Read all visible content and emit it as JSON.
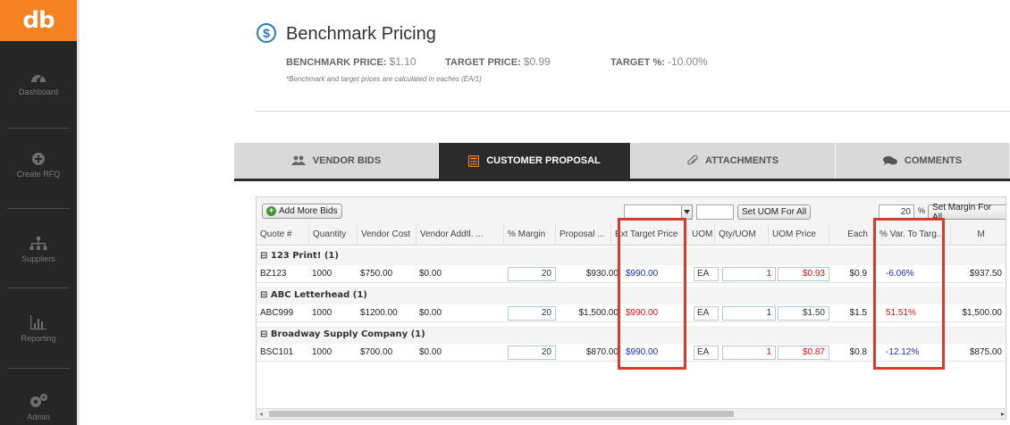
{
  "app": {
    "logo": "db"
  },
  "sidebar": {
    "items": [
      {
        "label": "Dashboard",
        "icon": "gauge-icon"
      },
      {
        "label": "Create RFQ",
        "icon": "plus-circle-icon"
      },
      {
        "label": "Suppliers",
        "icon": "org-chart-icon"
      },
      {
        "label": "Reporting",
        "icon": "bar-chart-icon"
      },
      {
        "label": "Admin",
        "icon": "gears-icon"
      }
    ]
  },
  "header": {
    "title": "Benchmark Pricing",
    "benchmark_label": "BENCHMARK PRICE:",
    "benchmark_value": "$1.10",
    "target_label": "TARGET PRICE:",
    "target_value": "$0.99",
    "target_pct_label": "TARGET %:",
    "target_pct_value": "-10.00%",
    "note": "*Benchmark and target prices are calculated in eaches (EA/1)"
  },
  "tabs": [
    {
      "label": "VENDOR BIDS",
      "icon": "users-icon",
      "active": false
    },
    {
      "label": "CUSTOMER PROPOSAL",
      "icon": "calculator-icon",
      "active": true
    },
    {
      "label": "ATTACHMENTS",
      "icon": "paperclip-icon",
      "active": false
    },
    {
      "label": "COMMENTS",
      "icon": "chat-icon",
      "active": false
    }
  ],
  "toolbar": {
    "add_bids_label": "Add More Bids",
    "uom_select_value": "",
    "uom_input_value": "",
    "set_uom_label": "Set UOM For All",
    "margin_value": "20",
    "margin_pct": "%",
    "set_margin_label": "Set Margin For All"
  },
  "columns": [
    "Quote #",
    "Quantity",
    "Vendor Cost",
    "Vendor Addtl. ...",
    "% Margin",
    "Proposal ...",
    "Ext Target Price",
    "UOM",
    "Qty/UOM",
    "UOM Price",
    "Each",
    "% Var. To Targ...",
    "M"
  ],
  "groups": [
    {
      "name": "123 Print! (1)",
      "row": {
        "quote": "BZ123",
        "quantity": "1000",
        "vendor_cost": "$750.00",
        "addtl": "$0.00",
        "margin": "20",
        "proposal": "$930.00",
        "ext_target": "$990.00",
        "ext_target_color": "blue",
        "uom": "EA",
        "qty_uom": "1",
        "qty_uom_red": true,
        "uom_price": "$0.93",
        "uom_price_red": true,
        "each": "$0.9",
        "var": "-6.06%",
        "var_color": "blue",
        "m": "$937.50"
      }
    },
    {
      "name": "ABC Letterhead (1)",
      "row": {
        "quote": "ABC999",
        "quantity": "1000",
        "vendor_cost": "$1200.00",
        "addtl": "$0.00",
        "margin": "20",
        "proposal": "$1,500.00",
        "ext_target": "$990.00",
        "ext_target_color": "red",
        "uom": "EA",
        "qty_uom": "1",
        "qty_uom_red": false,
        "uom_price": "$1.50",
        "uom_price_red": false,
        "each": "$1.5",
        "var": "51.51%",
        "var_color": "red",
        "m": "$1,500.00"
      }
    },
    {
      "name": "Broadway Supply Company (1)",
      "row": {
        "quote": "BSC101",
        "quantity": "1000",
        "vendor_cost": "$700.00",
        "addtl": "$0.00",
        "margin": "20",
        "proposal": "$870.00",
        "ext_target": "$990.00",
        "ext_target_color": "blue",
        "uom": "EA",
        "qty_uom": "1",
        "qty_uom_red": true,
        "uom_price": "$0.87",
        "uom_price_red": true,
        "each": "$0.8",
        "var": "-12.12%",
        "var_color": "blue",
        "m": "$875.00"
      }
    }
  ],
  "colors": {
    "accent": "#f58220",
    "sidebar": "#262626",
    "highlight": "#d93b2b",
    "blue_value": "#1a2ad8",
    "red_value": "#e01010"
  }
}
